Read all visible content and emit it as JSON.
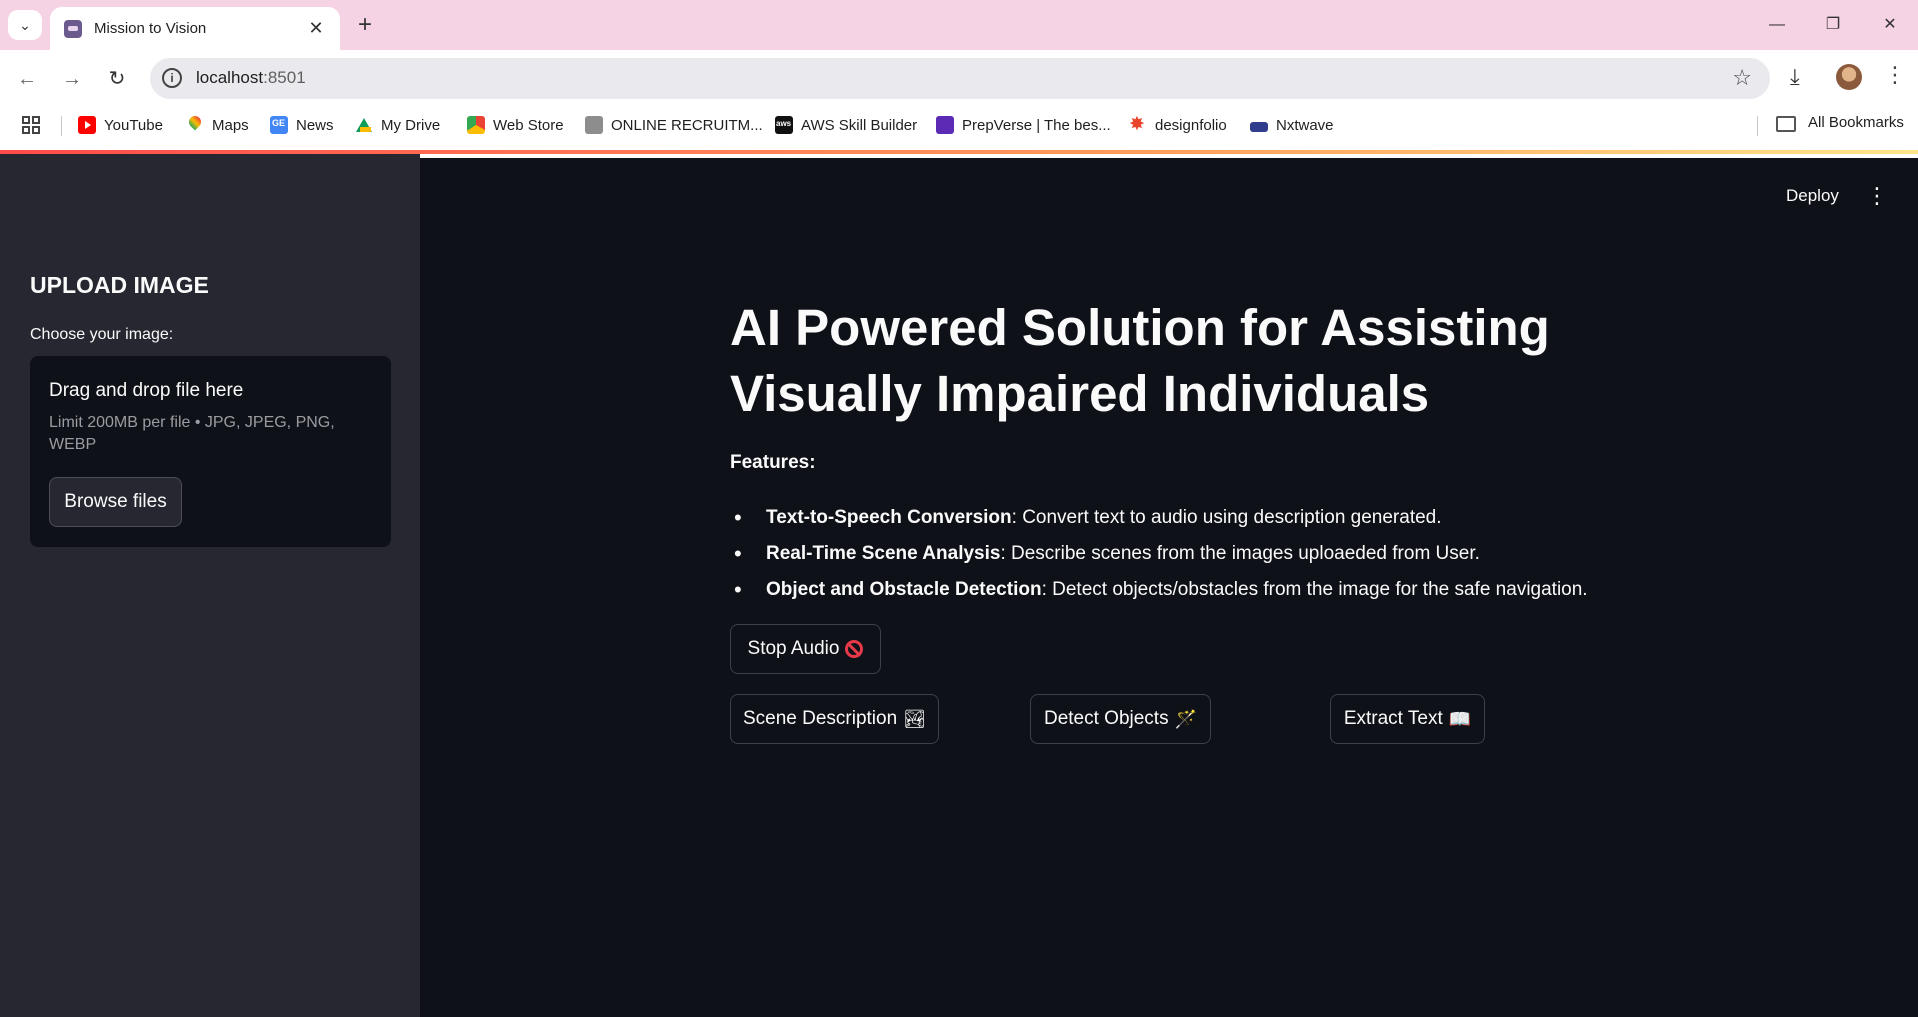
{
  "browser": {
    "tab_title": "Mission to Vision",
    "url_host": "localhost",
    "url_port": ":8501",
    "bookmarks": [
      {
        "label": "YouTube",
        "icon": "youtube-icon"
      },
      {
        "label": "Maps",
        "icon": "maps-icon"
      },
      {
        "label": "News",
        "icon": "news-icon"
      },
      {
        "label": "My Drive",
        "icon": "drive-icon"
      },
      {
        "label": "Web Store",
        "icon": "web-store-icon"
      },
      {
        "label": "ONLINE RECRUITM...",
        "icon": "emblem-icon"
      },
      {
        "label": "AWS Skill Builder",
        "icon": "aws-icon"
      },
      {
        "label": "PrepVerse | The bes...",
        "icon": "prepverse-icon"
      },
      {
        "label": "designfolio",
        "icon": "designfolio-icon"
      },
      {
        "label": "Nxtwave",
        "icon": "nxtwave-icon"
      }
    ],
    "all_bookmarks_label": "All Bookmarks"
  },
  "app": {
    "deploy_label": "Deploy",
    "sidebar": {
      "title": "UPLOAD IMAGE",
      "uploader_label": "Choose your image:",
      "dropzone_title": "Drag and drop file here",
      "dropzone_limit": "Limit 200MB per file • JPG, JPEG, PNG, WEBP",
      "browse_label": "Browse files"
    },
    "main": {
      "title": "AI Powered Solution for Assisting Visually Impaired Individuals",
      "features_label": "Features:",
      "features": [
        {
          "name": "Text-to-Speech Conversion",
          "desc": ": Convert text to audio using description generated."
        },
        {
          "name": "Real-Time Scene Analysis",
          "desc": ": Describe scenes from the images uploaeded from User."
        },
        {
          "name": "Object and Obstacle Detection",
          "desc": ": Detect objects/obstacles from the image for the safe navigation."
        }
      ],
      "buttons": {
        "stop_audio": "Stop Audio",
        "scene_description": "Scene Description",
        "scene_emoji": "🏞",
        "detect_objects": "Detect Objects",
        "detect_emoji": "🪄",
        "extract_text": "Extract Text",
        "extract_emoji": "📖"
      }
    }
  }
}
